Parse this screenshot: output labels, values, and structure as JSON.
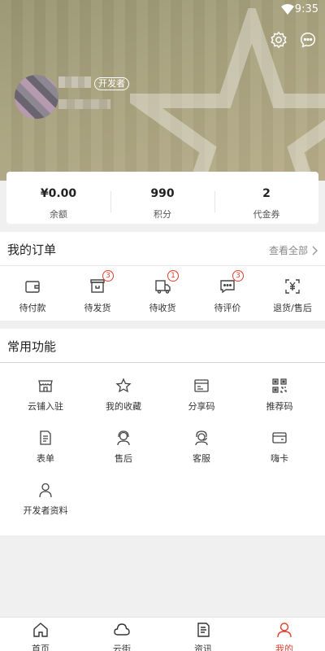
{
  "status_bar": {
    "time": "9:35"
  },
  "profile": {
    "developer_badge": "开发者"
  },
  "stats": [
    {
      "value": "¥0.00",
      "label": "余额"
    },
    {
      "value": "990",
      "label": "积分"
    },
    {
      "value": "2",
      "label": "代金券"
    }
  ],
  "orders": {
    "title": "我的订单",
    "view_all": "查看全部",
    "items": [
      {
        "label": "待付款",
        "icon": "wallet-icon"
      },
      {
        "label": "待发货",
        "icon": "box-icon",
        "badge": "3"
      },
      {
        "label": "待收货",
        "icon": "truck-icon",
        "badge": "1"
      },
      {
        "label": "待评价",
        "icon": "comment-icon",
        "badge": "3"
      },
      {
        "label": "退货/售后",
        "icon": "refund-icon"
      }
    ]
  },
  "functions": {
    "title": "常用功能",
    "items": [
      {
        "label": "云铺入驻",
        "icon": "store-icon"
      },
      {
        "label": "我的收藏",
        "icon": "star-icon"
      },
      {
        "label": "分享码",
        "icon": "card-code-icon"
      },
      {
        "label": "推荐码",
        "icon": "qr-code-icon"
      },
      {
        "label": "表单",
        "icon": "form-icon"
      },
      {
        "label": "售后",
        "icon": "service-person-icon"
      },
      {
        "label": "客服",
        "icon": "headset-icon"
      },
      {
        "label": "嗨卡",
        "icon": "card-icon"
      },
      {
        "label": "开发者资料",
        "icon": "user-icon"
      }
    ]
  },
  "tabbar": {
    "active_color": "#e0402e",
    "tabs": [
      {
        "label": "首页",
        "icon": "home-icon"
      },
      {
        "label": "云街",
        "icon": "cloud-icon"
      },
      {
        "label": "资讯",
        "icon": "news-icon"
      },
      {
        "label": "我的",
        "icon": "profile-icon",
        "active": true
      }
    ]
  }
}
